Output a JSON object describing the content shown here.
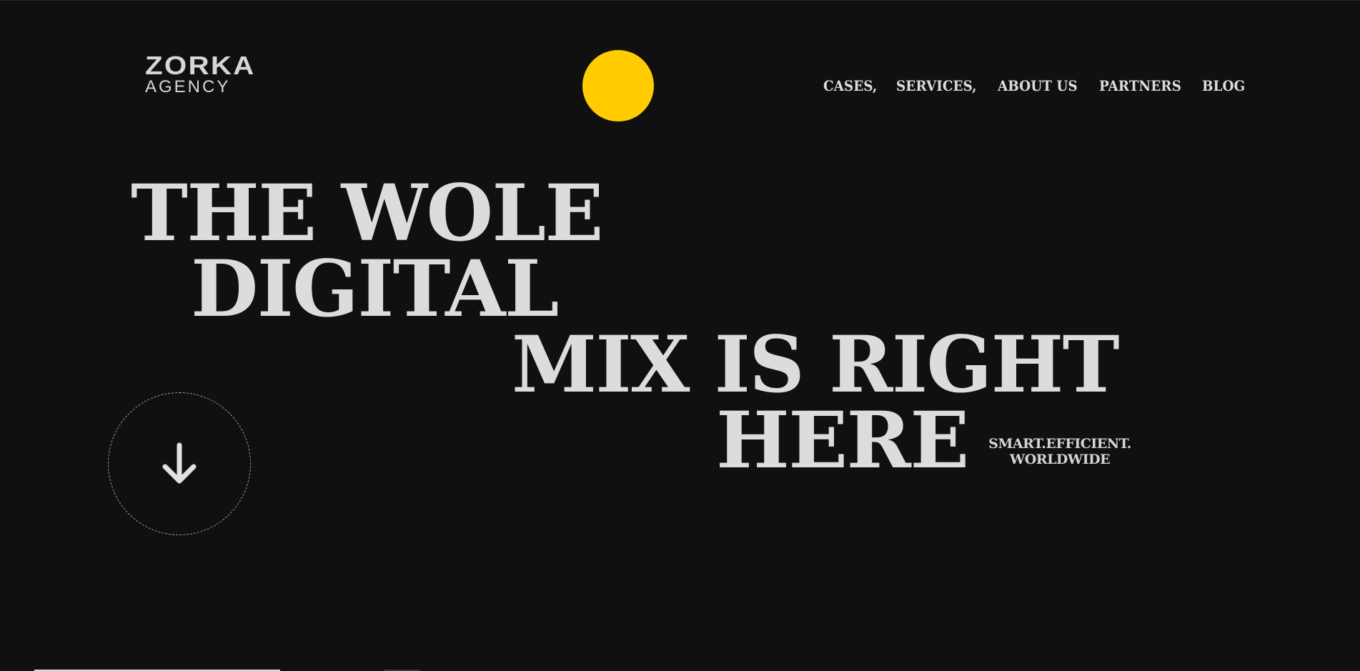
{
  "logo": {
    "brand": "ZORKA",
    "sub": "AGENCY"
  },
  "nav": {
    "items": [
      {
        "label": "CASES,"
      },
      {
        "label": "SERVICES,"
      },
      {
        "label": "ABOUT US"
      },
      {
        "label": "PARTNERS"
      },
      {
        "label": "BLOG"
      }
    ]
  },
  "hero": {
    "lines": [
      "THE WOLE",
      "DIGITAL",
      "MIX IS RIGHT",
      "HERE"
    ],
    "tagline_1": "SMART.EFFICIENT.",
    "tagline_2": "WORLDWIDE"
  },
  "icons": {
    "scroll": "arrow-down-icon",
    "sun": "yellow-circle"
  },
  "colors": {
    "background": "#101010",
    "text": "#dcdcdc",
    "accent": "#ffcc02"
  }
}
